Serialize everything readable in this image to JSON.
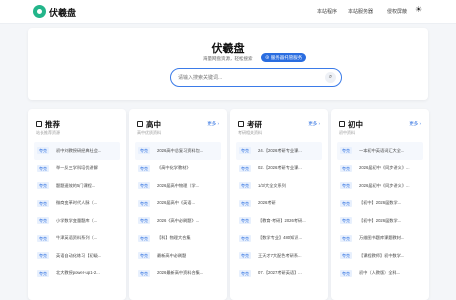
{
  "header": {
    "brand": "伏羲盘",
    "nav": [
      "本站程序",
      "本站服务器",
      "侵权屏蔽"
    ],
    "theme_icon": "sun-icon"
  },
  "hero": {
    "title": "伏羲盘",
    "subtitle": "海量网盘资源，轻松搜索",
    "badge": "服务器托管服务",
    "search_placeholder": "请输入搜索关键词..."
  },
  "sections": [
    {
      "title": "推荐",
      "subtitle": "站长推荐资源",
      "more": "",
      "tag": "夸克",
      "items": [
        "初中刘教授研经典社会...",
        "举一反三学科培优讲解",
        "题题速效的5门课程...",
        "微商变革时代人脉（...",
        "小学数学变量题库（...",
        "牛津英语资料系列（...",
        "英语自动化练习【初级...",
        "北大教授power-up1-2..."
      ]
    },
    {
      "title": "高中",
      "subtitle": "高中优质资料",
      "more": "更多 ›",
      "tag": "夸克",
      "items": [
        "2026高中总复习资料包...",
        "《高中化学教材》",
        "2026届高中物理（学...",
        "2026届高中《英语...",
        "2026《高中必刷题》...",
        "【科】物理大合集",
        "最新高中必刷题",
        "2026最新高中资料合集..."
      ]
    },
    {
      "title": "考研",
      "subtitle": "考研相关资料",
      "more": "更多 ›",
      "tag": "夸克",
      "items": [
        "24.【2026考研专业课...",
        "02.【2026考研专业课...",
        "1/3/大全文系列",
        "2026考研",
        "【教育-考研】2026考研...",
        "【数学专业】480知识...",
        "王天才7大配色考研系...",
        "07.【2027考研英语】..."
      ]
    },
    {
      "title": "初中",
      "subtitle": "初中资料",
      "more": "更多 ›",
      "tag": "夸克",
      "items": [
        "一本初中英语词汇大全...",
        "2026届初中《同步讲义》...",
        "2026届初中《同步讲义》...",
        "【初中】2026届数学...",
        "【初中】2026届数学...",
        "万维图书题库课题教材...",
        "【课程教师】初中数学...",
        "初中（人教版）全科..."
      ]
    }
  ]
}
